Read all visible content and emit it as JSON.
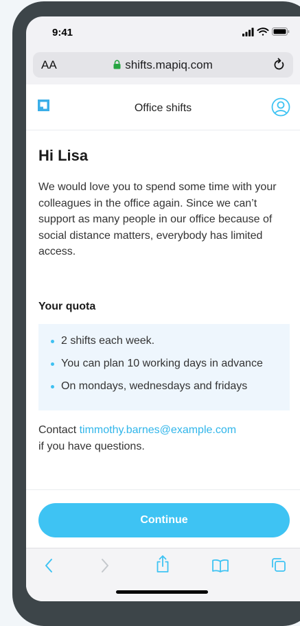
{
  "status_bar": {
    "time": "9:41"
  },
  "browser": {
    "text_size_label": "AA",
    "url": "shifts.mapiq.com"
  },
  "app": {
    "title": "Office shifts"
  },
  "main": {
    "greeting": "Hi Lisa",
    "intro": "We would love you to spend some time with your colleagues in the office again. Since we can’t support as many people in our office because of social distance matters, everybody has limited access.",
    "quota_heading": "Your quota",
    "quota_items": [
      "2 shifts each week.",
      "You can plan 10 working days in advance",
      "On mondays, wednesdays and fridays"
    ],
    "contact_prefix": "Contact ",
    "contact_email": "timmothy.barnes@example.com",
    "contact_suffix": "if you have questions.",
    "continue_label": "Continue"
  },
  "colors": {
    "accent": "#3ec3f3",
    "brand": "#3aaee8",
    "quota_background": "#eef6fd",
    "frame": "#3d4549",
    "page_background": "#f2f6f9"
  },
  "icons": {
    "status": [
      "signal-icon",
      "wifi-icon",
      "battery-icon"
    ],
    "browser": [
      "lock-icon",
      "reload-icon"
    ],
    "app": [
      "mapiq-logo-icon",
      "user-account-icon"
    ],
    "toolbar": [
      "back-icon",
      "forward-icon",
      "share-icon",
      "bookmarks-icon",
      "tabs-icon"
    ]
  }
}
